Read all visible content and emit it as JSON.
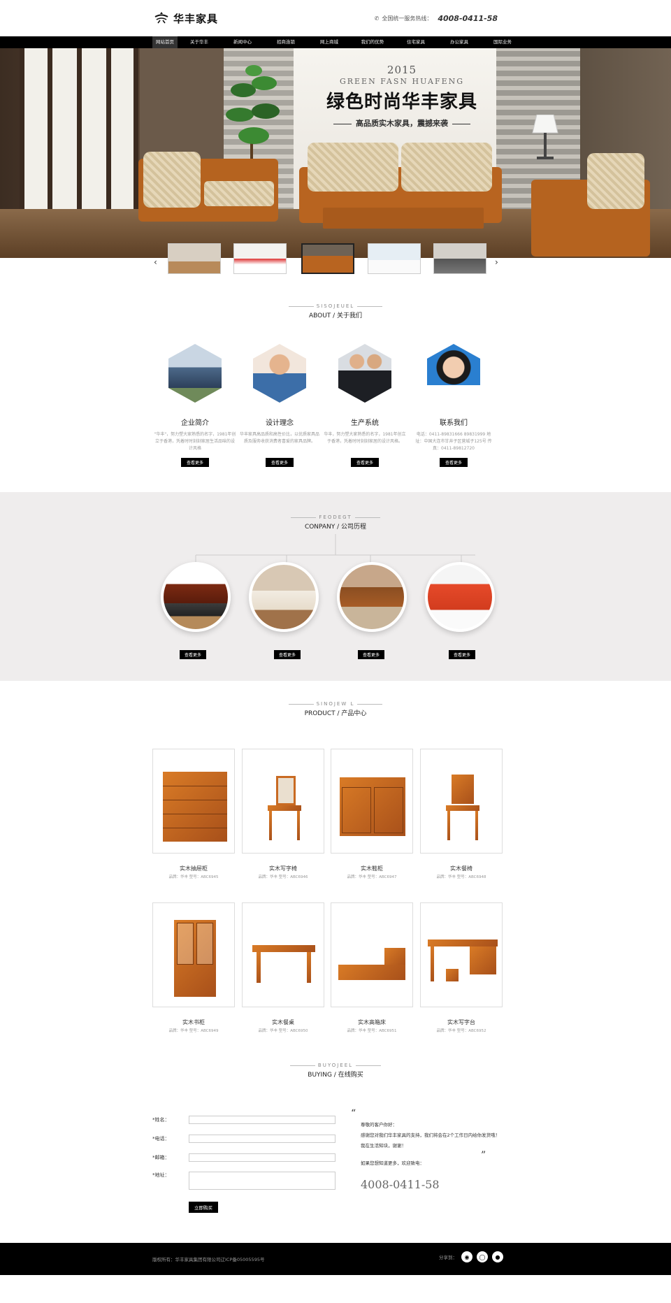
{
  "header": {
    "logo_text": "华丰家具",
    "hotline_label": "全国统一服务热线：",
    "hotline_number": "4008-0411-58"
  },
  "nav": {
    "items": [
      "网站首页",
      "关于华丰",
      "新闻中心",
      "招商连锁",
      "网上商城",
      "我们的优势",
      "住宅家具",
      "办公家具",
      "国际业务"
    ]
  },
  "hero": {
    "year": "2015",
    "english": "GREEN FASN HUAFENG",
    "title": "绿色时尚华丰家具",
    "subtitle": "高品质实木家具，震撼来袭"
  },
  "about": {
    "en": "SISOJEUEL",
    "cn_prefix": "ABOUT",
    "cn": "关于我们",
    "items": [
      {
        "title": "企业简介",
        "text": "\"华丰\"，努力塑大家熟悉的名字，1981年创立于香港，凭着时时刻刻家居生活品味的设计风格",
        "button": "查看更多"
      },
      {
        "title": "设计理念",
        "text": "华丰家具高品质和高性价比，以优质家具品质及服务收获消费者喜爱的家具品牌。",
        "button": "查看更多"
      },
      {
        "title": "生产系统",
        "text": "华丰，努力塑大家熟悉的名字，1981年创立于香港，凭着时时刻刻家居的设计风格。",
        "button": "查看更多"
      },
      {
        "title": "联系我们",
        "text": "电话：0411-89831666 89831999 地址：中国大连市甘井子区营城子125号 传真：0411-89812720",
        "button": "查看更多"
      }
    ]
  },
  "history": {
    "en": "FEODEGT",
    "cn_prefix": "CONPANY",
    "cn": "公司历程",
    "button": "查看更多"
  },
  "products": {
    "en": "SINOJEW L",
    "cn_prefix": "PRODUCT",
    "cn": "产品中心",
    "items": [
      {
        "name": "实木抽屉柜",
        "meta": "品牌：华丰  型号：ABC6945"
      },
      {
        "name": "实木写字椅",
        "meta": "品牌：华丰  型号：ABC6946"
      },
      {
        "name": "实木鞋柜",
        "meta": "品牌：华丰  型号：ABC6947"
      },
      {
        "name": "实木餐椅",
        "meta": "品牌：华丰  型号：ABC6948"
      },
      {
        "name": "实木书柜",
        "meta": "品牌：华丰  型号：ABC6949"
      },
      {
        "name": "实木餐桌",
        "meta": "品牌：华丰  型号：ABC6950"
      },
      {
        "name": "实木高箱床",
        "meta": "品牌：华丰  型号：ABC6951"
      },
      {
        "name": "实木写字台",
        "meta": "品牌：华丰  型号：ABC6952"
      }
    ]
  },
  "buying": {
    "en": "BUYOJEEL",
    "cn_prefix": "BUYING",
    "cn": "在线购买",
    "fields": [
      "*姓名：",
      "*电话：",
      "*邮箱：",
      "*地址："
    ],
    "submit": "立即购买",
    "greeting": "尊敬的客户你好：",
    "message1": "感谢您对我们华丰家具的支持，我们将会在2个工作日内给你发货哦！",
    "message2": "我在生活知块，谢谢！",
    "message3": "如果您想知道更多，欢迎致电：",
    "phone": "4008-0411-58"
  },
  "footer": {
    "copyright": "版权所有：华丰家具集团有限公司辽ICP备05005595号",
    "share_label": "分享到："
  }
}
